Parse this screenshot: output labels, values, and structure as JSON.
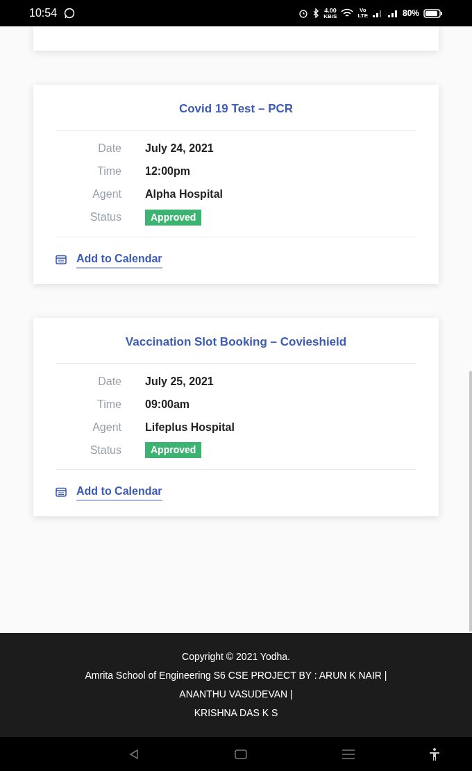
{
  "status_bar": {
    "time": "10:54",
    "speed_value": "4.00",
    "speed_unit": "KB/S",
    "network_top": "Vo",
    "network_bottom": "LTE",
    "battery": "80%"
  },
  "appointments": [
    {
      "title": "Covid 19 Test – PCR",
      "details": [
        {
          "label": "Date",
          "value": "July 24, 2021"
        },
        {
          "label": "Time",
          "value": "12:00pm"
        },
        {
          "label": "Agent",
          "value": "Alpha Hospital"
        }
      ],
      "status_label": "Status",
      "status": "Approved",
      "link": "Add to Calendar"
    },
    {
      "title": "Vaccination Slot Booking – Covieshield",
      "details": [
        {
          "label": "Date",
          "value": "July 25, 2021"
        },
        {
          "label": "Time",
          "value": "09:00am"
        },
        {
          "label": "Agent",
          "value": "Lifeplus Hospital"
        }
      ],
      "status_label": "Status",
      "status": "Approved",
      "link": "Add to Calendar"
    }
  ],
  "footer": {
    "lines": [
      "Copyright © 2021 Yodha.",
      "Amrita School of Engineering S6 CSE PROJECT BY : ARUN K NAIR |",
      "ANANTHU VASUDEVAN |",
      "KRISHNA DAS K S"
    ]
  }
}
